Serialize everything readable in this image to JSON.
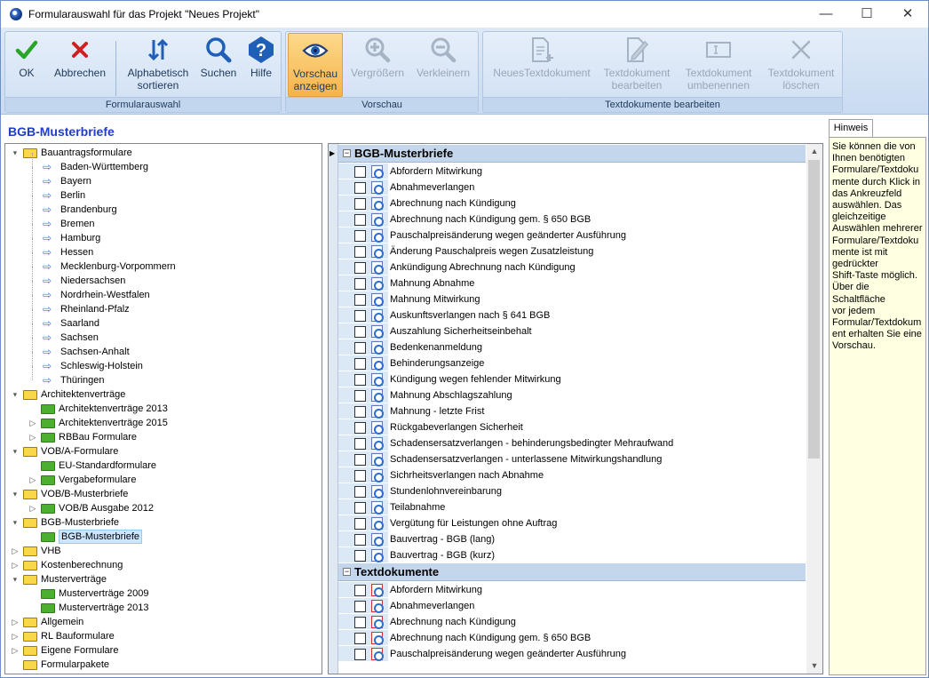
{
  "window": {
    "title": "Formularauswahl für das Projekt \"Neues Projekt\"",
    "controls": [
      "—",
      "☐",
      "✕"
    ]
  },
  "ribbon": {
    "groups": [
      {
        "label": "Formularauswahl",
        "buttons": [
          "OK",
          "Abbrechen",
          "Alphabetisch sortieren",
          "Suchen",
          "Hilfe"
        ]
      },
      {
        "label": "Vorschau",
        "buttons": [
          "Vorschau anzeigen",
          "Vergrößern",
          "Verkleinern"
        ]
      },
      {
        "label": "Textdokumente bearbeiten",
        "buttons": [
          "NeuesTextdokument",
          "Textdokument bearbeiten",
          "Textdokument umbenennen",
          "Textdokument löschen"
        ]
      }
    ],
    "colors": {
      "ok": "#2aa52a",
      "cancel": "#d01f1f",
      "icon_blue": "#1f5fb8",
      "disabled": "#97a6b9"
    }
  },
  "panel_title": "BGB-Musterbriefe",
  "tree": [
    {
      "label": "Bauantragsformulare",
      "depth": 0,
      "expanded": true,
      "icon": "folder-yellow"
    },
    {
      "label": "Baden-Württemberg",
      "depth": 1,
      "icon": "arrow"
    },
    {
      "label": "Bayern",
      "depth": 1,
      "icon": "arrow"
    },
    {
      "label": "Berlin",
      "depth": 1,
      "icon": "arrow"
    },
    {
      "label": "Brandenburg",
      "depth": 1,
      "icon": "arrow"
    },
    {
      "label": "Bremen",
      "depth": 1,
      "icon": "arrow"
    },
    {
      "label": "Hamburg",
      "depth": 1,
      "icon": "arrow"
    },
    {
      "label": "Hessen",
      "depth": 1,
      "icon": "arrow"
    },
    {
      "label": "Mecklenburg-Vorpommern",
      "depth": 1,
      "icon": "arrow"
    },
    {
      "label": "Niedersachsen",
      "depth": 1,
      "icon": "arrow"
    },
    {
      "label": "Nordrhein-Westfalen",
      "depth": 1,
      "icon": "arrow"
    },
    {
      "label": "Rheinland-Pfalz",
      "depth": 1,
      "icon": "arrow"
    },
    {
      "label": "Saarland",
      "depth": 1,
      "icon": "arrow"
    },
    {
      "label": "Sachsen",
      "depth": 1,
      "icon": "arrow"
    },
    {
      "label": "Sachsen-Anhalt",
      "depth": 1,
      "icon": "arrow"
    },
    {
      "label": "Schleswig-Holstein",
      "depth": 1,
      "icon": "arrow"
    },
    {
      "label": "Thüringen",
      "depth": 1,
      "icon": "arrow"
    },
    {
      "label": "Architektenverträge",
      "depth": 0,
      "expanded": true,
      "icon": "folder-yellow"
    },
    {
      "label": "Architektenverträge 2013",
      "depth": 1,
      "icon": "folder-green"
    },
    {
      "label": "Architektenverträge 2015",
      "depth": 1,
      "collapsed": true,
      "icon": "folder-green"
    },
    {
      "label": "RBBau Formulare",
      "depth": 1,
      "collapsed": true,
      "icon": "folder-green"
    },
    {
      "label": "VOB/A-Formulare",
      "depth": 0,
      "expanded": true,
      "icon": "folder-yellow"
    },
    {
      "label": "EU-Standardformulare",
      "depth": 1,
      "icon": "folder-green"
    },
    {
      "label": "Vergabeformulare",
      "depth": 1,
      "collapsed": true,
      "icon": "folder-green"
    },
    {
      "label": "VOB/B-Musterbriefe",
      "depth": 0,
      "expanded": true,
      "icon": "folder-yellow"
    },
    {
      "label": "VOB/B Ausgabe 2012",
      "depth": 1,
      "collapsed": true,
      "icon": "folder-green"
    },
    {
      "label": "BGB-Musterbriefe",
      "depth": 0,
      "expanded": true,
      "icon": "folder-yellow"
    },
    {
      "label": "BGB-Musterbriefe",
      "depth": 1,
      "selected": true,
      "icon": "folder-green"
    },
    {
      "label": "VHB",
      "depth": 0,
      "collapsed": true,
      "icon": "folder-yellow"
    },
    {
      "label": "Kostenberechnung",
      "depth": 0,
      "collapsed": true,
      "icon": "folder-yellow"
    },
    {
      "label": "Musterverträge",
      "depth": 0,
      "expanded": true,
      "icon": "folder-yellow"
    },
    {
      "label": "Musterverträge 2009",
      "depth": 1,
      "icon": "folder-green"
    },
    {
      "label": "Musterverträge 2013",
      "depth": 1,
      "icon": "folder-green"
    },
    {
      "label": "Allgemein",
      "depth": 0,
      "collapsed": true,
      "icon": "folder-yellow"
    },
    {
      "label": "RL Bauformulare",
      "depth": 0,
      "collapsed": true,
      "icon": "folder-yellow"
    },
    {
      "label": "Eigene Formulare",
      "depth": 0,
      "collapsed": true,
      "icon": "folder-yellow"
    },
    {
      "label": "Formularpakete",
      "depth": 0,
      "icon": "folder-yellow"
    }
  ],
  "grid": {
    "groups": [
      {
        "title": "BGB-Musterbriefe",
        "doc_icon": "blue",
        "rows": [
          "Abfordern Mitwirkung",
          "Abnahmeverlangen",
          "Abrechnung nach Kündigung",
          "Abrechnung nach Kündigung gem. § 650 BGB",
          "Pauschalpreisänderung wegen geänderter Ausführung",
          "Änderung Pauschalpreis wegen  Zusatzleistung",
          "Ankündigung Abrechnung nach Kündigung",
          "Mahnung Abnahme",
          "Mahnung Mitwirkung",
          "Auskunftsverlangen nach § 641 BGB",
          "Auszahlung Sicherheitseinbehalt",
          "Bedenkenanmeldung",
          "Behinderungsanzeige",
          "Kündigung wegen fehlender Mitwirkung",
          "Mahnung Abschlagszahlung",
          "Mahnung - letzte Frist",
          "Rückgabeverlangen Sicherheit",
          "Schadensersatzverlangen - behinderungsbedingter Mehraufwand",
          "Schadensersatzverlangen - unterlassene Mitwirkungshandlung",
          "Sichrheitsverlangen nach Abnahme",
          "Stundenlohnvereinbarung",
          "Teilabnahme",
          "Vergütung für Leistungen ohne Auftrag",
          "Bauvertrag - BGB (lang)",
          "Bauvertrag - BGB (kurz)"
        ]
      },
      {
        "title": "Textdokumente",
        "doc_icon": "red",
        "rows": [
          "Abfordern Mitwirkung",
          "Abnahmeverlangen",
          "Abrechnung nach Kündigung",
          "Abrechnung nach Kündigung gem. § 650 BGB",
          "Pauschalpreisänderung wegen geänderter Ausführung"
        ]
      }
    ]
  },
  "hint": {
    "tab": "Hinweis",
    "text": "Sie können die von\nIhnen benötigten\nFormulare/Textdoku\nmente durch Klick in\ndas Ankreuzfeld\nauswählen. Das\ngleichzeitige\nAuswählen mehrerer\nFormulare/Textdoku\nmente ist mit\ngedrückter\nShift-Taste möglich.\nÜber die Schaltfläche\nvor jedem\nFormular/Textdokum\nent erhalten Sie eine\nVorschau."
  }
}
